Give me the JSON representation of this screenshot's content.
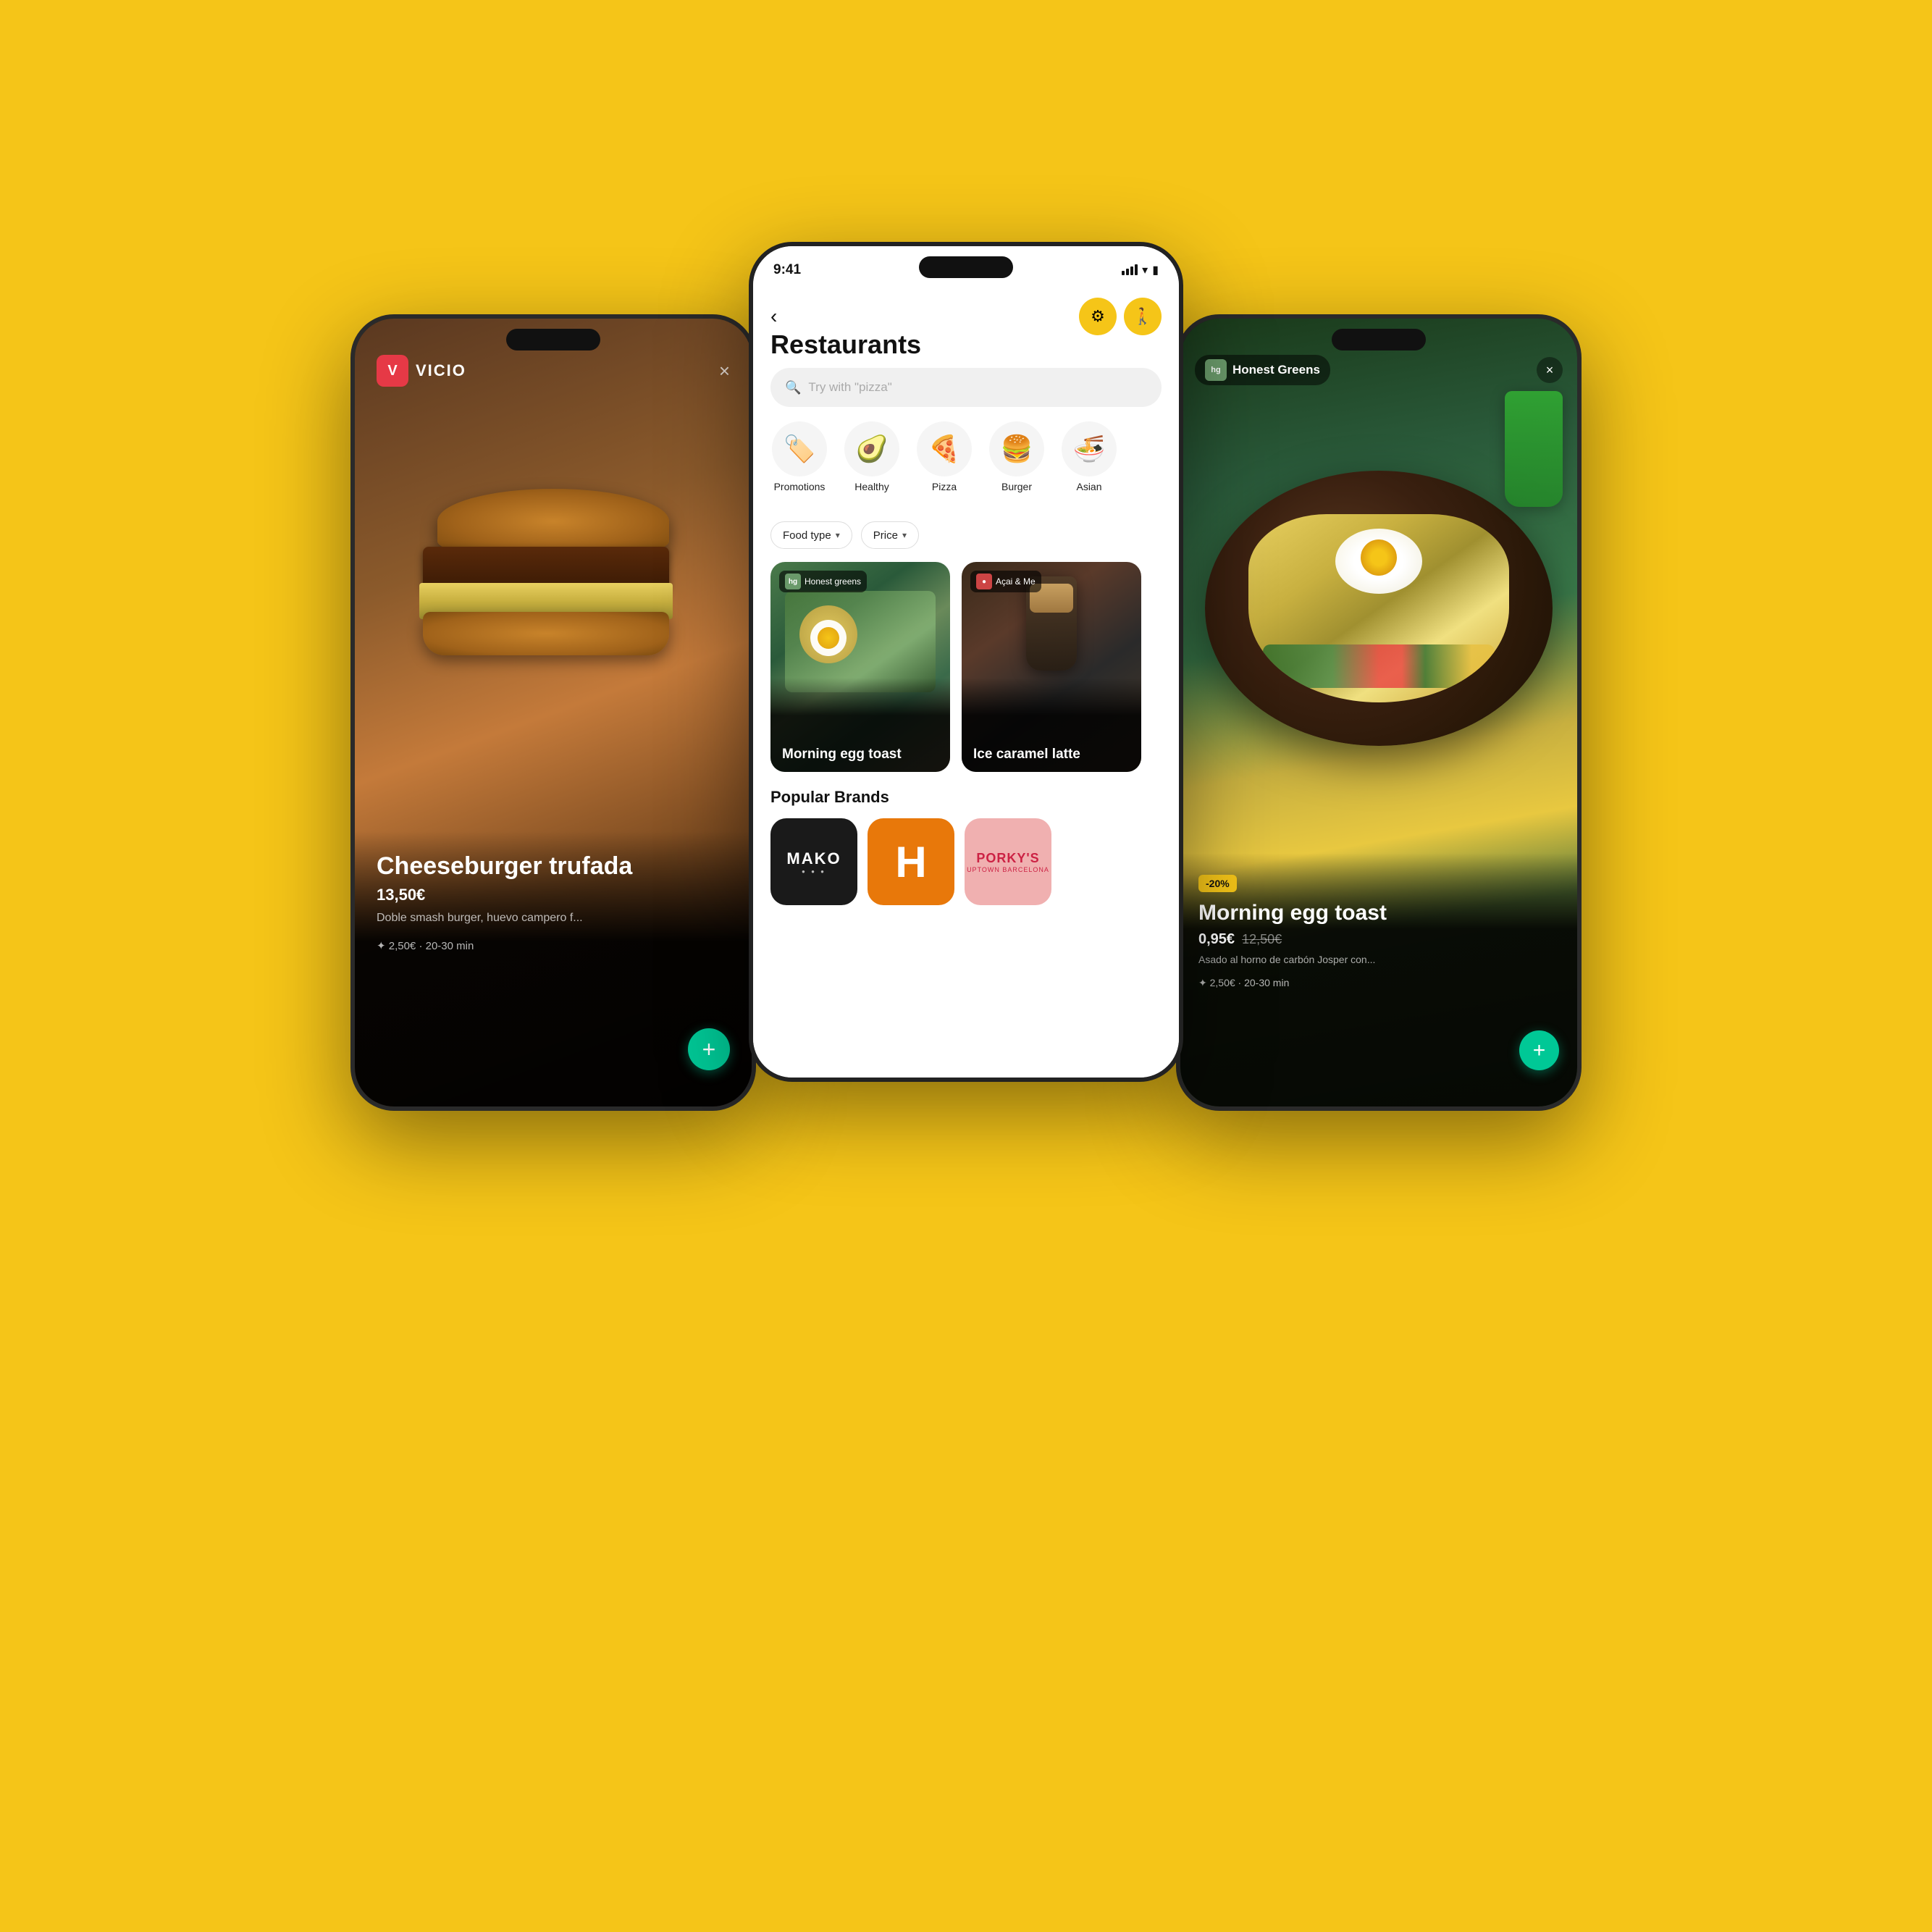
{
  "background": "#F5C518",
  "left_phone": {
    "brand_name": "VICIO",
    "close_label": "×",
    "product_name": "Cheeseburger trufada",
    "product_price": "13,50€",
    "product_description": "Doble smash burger, huevo campero f...",
    "product_delivery": "✦ 2,50€ · 20-30 min",
    "add_button": "+"
  },
  "center_phone": {
    "status_time": "9:41",
    "page_title": "Restaurants",
    "search_placeholder": "Try with \"pizza\"",
    "categories": [
      {
        "emoji": "🏷️",
        "label": "Promotions"
      },
      {
        "emoji": "🥑",
        "label": "Healthy"
      },
      {
        "emoji": "🍕",
        "label": "Pizza"
      },
      {
        "emoji": "🍔",
        "label": "Burger"
      },
      {
        "emoji": "🍜",
        "label": "Asian"
      }
    ],
    "filters": [
      {
        "label": "Food type"
      },
      {
        "label": "Price"
      }
    ],
    "restaurant_cards": [
      {
        "badge": "hg",
        "brand": "Honest greens",
        "dish": "Morning egg toast"
      },
      {
        "badge": "●",
        "brand": "Açai & Me",
        "dish": "Ice caramel latte"
      }
    ],
    "popular_brands_title": "Popular Brands",
    "brands": [
      {
        "name": "MAKO",
        "bg": "#1a1a1a",
        "text_color": "white"
      },
      {
        "name": "H",
        "bg": "#e8780a",
        "text_color": "white"
      },
      {
        "name": "PORKY'S",
        "bg": "#f0b0b0",
        "text_color": "#cc2244"
      }
    ]
  },
  "right_phone": {
    "brand_badge": "hg",
    "brand_name": "Honest Greens",
    "close_label": "×",
    "discount_badge": "-20%",
    "product_name": "Morning egg toast",
    "price_current": "0,95€",
    "price_original": "12,50€",
    "product_description": "Asado al horno de carbón Josper con...",
    "product_delivery": "✦ 2,50€ · 20-30 min",
    "add_button": "+"
  }
}
